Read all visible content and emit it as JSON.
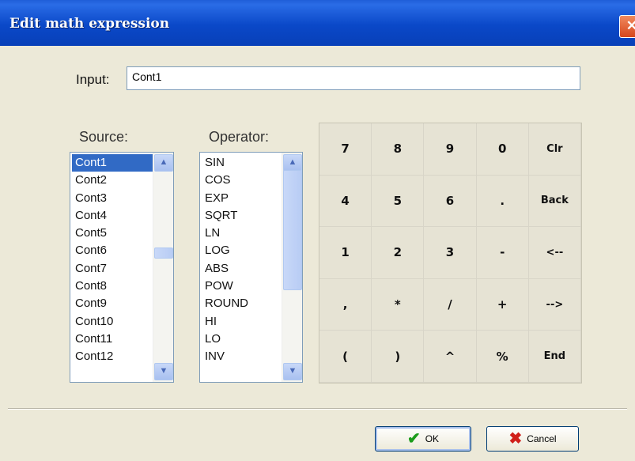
{
  "window": {
    "title": "Edit math expression",
    "close_glyph": "✕"
  },
  "input": {
    "label": "Input:",
    "value": "Cont1"
  },
  "source": {
    "label": "Source:",
    "items": [
      "Cont1",
      "Cont2",
      "Cont3",
      "Cont4",
      "Cont5",
      "Cont6",
      "Cont7",
      "Cont8",
      "Cont9",
      "Cont10",
      "Cont11",
      "Cont12"
    ],
    "selected": "Cont1"
  },
  "operator": {
    "label": "Operator:",
    "items": [
      "SIN",
      "COS",
      "EXP",
      "SQRT",
      "LN",
      "LOG",
      "ABS",
      "POW",
      "ROUND",
      "HI",
      "LO",
      "INV"
    ]
  },
  "keypad": {
    "keys": [
      "7",
      "8",
      "9",
      "0",
      "Clr",
      "4",
      "5",
      "6",
      ".",
      "Back",
      "1",
      "2",
      "3",
      "-",
      "<--",
      ",",
      "*",
      "/",
      "+",
      "-->",
      "(",
      ")",
      "^",
      "%",
      "End"
    ]
  },
  "buttons": {
    "ok_label": "OK",
    "cancel_label": "Cancel"
  },
  "colors": {
    "title_bar": "#0a48c8",
    "selection": "#316ac5",
    "ok_check": "#1c9c1c",
    "cancel_x": "#d0201a"
  },
  "icons": {
    "ok": "check-icon",
    "cancel": "cross-icon",
    "close": "close-icon",
    "scroll_up": "arrow-up-icon",
    "scroll_down": "arrow-down-icon"
  }
}
